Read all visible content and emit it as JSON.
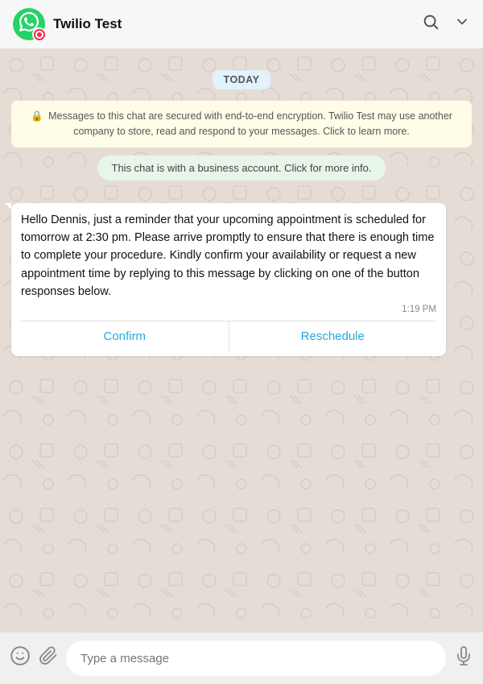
{
  "header": {
    "title": "Twilio Test",
    "search_label": "Search",
    "menu_label": "Menu"
  },
  "date_badge": {
    "label": "TODAY"
  },
  "encryption_notice": {
    "text": "Messages to this chat are secured with end-to-end encryption. Twilio Test may use another company to store, read and respond to your messages. Click to learn more."
  },
  "business_notice": {
    "text": "This chat is with a business account. Click for more info."
  },
  "message": {
    "text": "Hello Dennis, just a reminder that your upcoming appointment is scheduled for tomorrow at 2:30 pm. Please arrive promptly to ensure that there is enough time to complete your procedure. Kindly confirm your availability or request a new appointment time by replying to this message by clicking on one of the button responses below.",
    "time": "1:19 PM"
  },
  "quick_replies": {
    "confirm_label": "Confirm",
    "reschedule_label": "Reschedule"
  },
  "input_area": {
    "placeholder": "Type a message",
    "emoji_icon": "emoji-icon",
    "attachment_icon": "attachment-icon",
    "mic_icon": "mic-icon"
  }
}
